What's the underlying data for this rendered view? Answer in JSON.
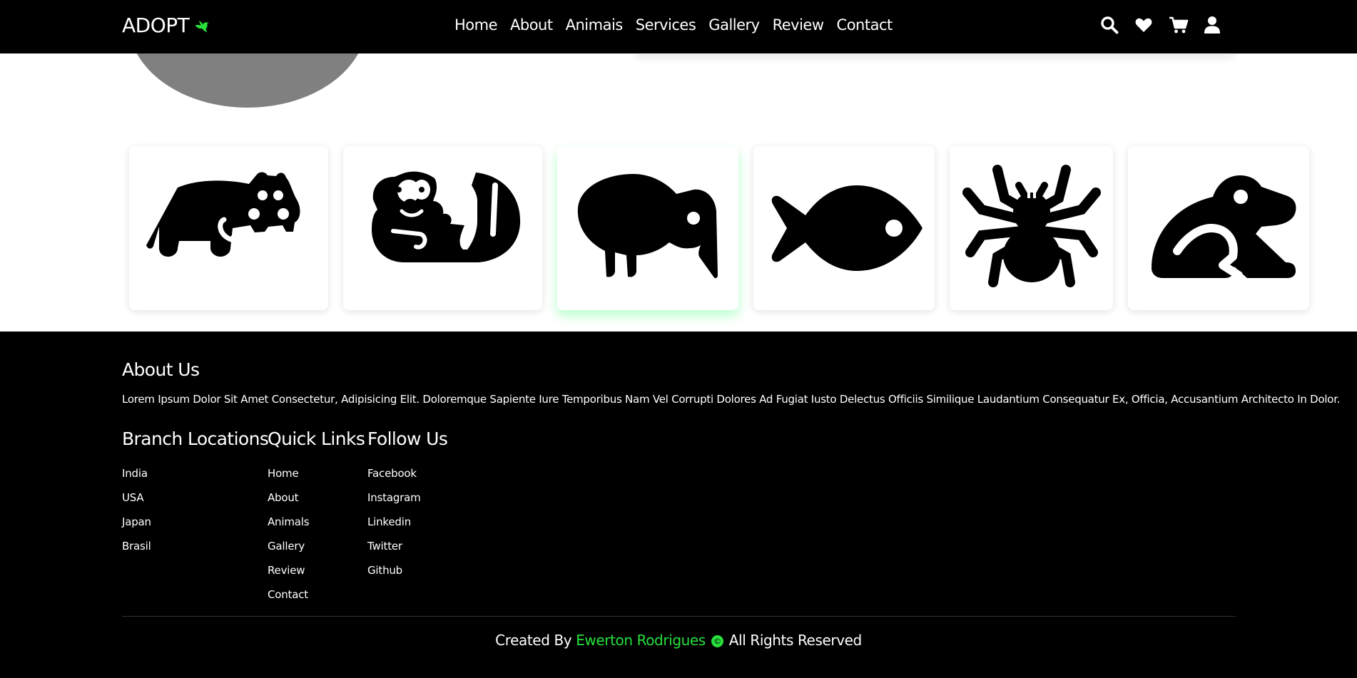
{
  "header": {
    "brand": "ADOPT",
    "nav": [
      "Home",
      "About",
      "Animais",
      "Services",
      "Gallery",
      "Review",
      "Contact"
    ],
    "icons": [
      "search-icon",
      "heart-icon",
      "cart-icon",
      "user-icon"
    ]
  },
  "animals": [
    "hippo-icon",
    "otter-icon",
    "kiwi-bird-icon",
    "fish-icon",
    "spider-icon",
    "frog-icon"
  ],
  "colors": {
    "accent": "#28e03c",
    "footer_bg": "#000000",
    "blob": "#808080"
  },
  "footer": {
    "about_title": "About Us",
    "about_text": "Lorem Ipsum Dolor Sit Amet Consectetur, Adipisicing Elit. Doloremque Sapiente Iure Temporibus Nam Vel Corrupti Dolores Ad Fugiat Iusto Delectus Officiis Similique Laudantium Consequatur Ex, Officia, Accusantium Architecto In Dolor.",
    "branches": {
      "title": "Branch Locations",
      "items": [
        "India",
        "USA",
        "Japan",
        "Brasil"
      ]
    },
    "quick_links": {
      "title": "Quick Links",
      "items": [
        "Home",
        "About",
        "Animals",
        "Gallery",
        "Review",
        "Contact"
      ]
    },
    "follow": {
      "title": "Follow Us",
      "items": [
        "Facebook",
        "Instagram",
        "Linkedin",
        "Twitter",
        "Github"
      ]
    },
    "credit_prefix": "Created By",
    "credit_author": "Ewerton Rodrigues",
    "credit_symbol": "©",
    "credit_suffix": "All Rights Reserved"
  }
}
